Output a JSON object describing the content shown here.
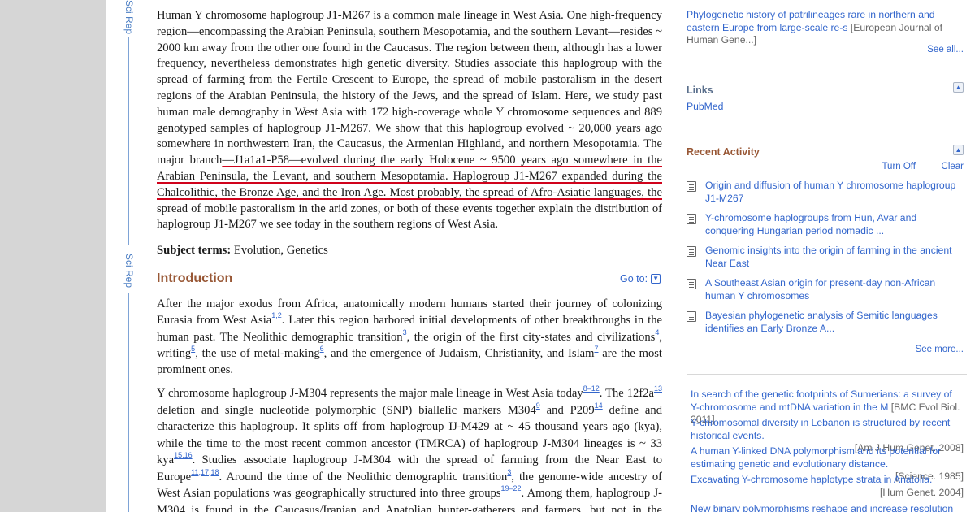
{
  "journal": {
    "tag": "Sci Rep"
  },
  "abstract": {
    "before": "Human Y chromosome haplogroup J1-M267 is a common male lineage in West Asia. One high-frequency region—encompassing the Arabian Peninsula, southern Mesopotamia, and the southern Levant—resides ~ 2000 km away from the other one found in the Caucasus. The region between them, although has a lower frequency, nevertheless demonstrates high genetic diversity. Studies associate this haplogroup with the spread of farming from the Fertile Crescent to Europe, the spread of mobile pastoralism in the desert regions of the Arabian Peninsula, the history of the Jews, and the spread of Islam. Here, we study past human male demography in West Asia with 172 high-coverage whole Y chromosome sequences and 889 genotyped samples of haplogroup J1-M267. We show that this haplogroup evolved ~ 20,000 years ago somewhere in northwestern Iran, the Caucasus, the Armenian Highland, and northern Mesopotamia. The major branch",
    "highlighted": "—J1a1a1-P58—evolved during the early Holocene ~ 9500 years ago somewhere in the Arabian Peninsula, the Levant, and southern Mesopotamia. Haplogroup J1-M267 expanded during the Chalcolithic, the Bronze Age, and the Iron Age. Most probably, the spread of Afro-Asiatic languages, the",
    "after": " spread of mobile pastoralism in the arid zones, or both of these events together explain the distribution of haplogroup J1-M267 we see today in the southern regions of West Asia."
  },
  "subject_terms": {
    "label": "Subject terms:",
    "value": " Evolution, Genetics"
  },
  "introduction": {
    "title": "Introduction",
    "goto_label": "Go to:",
    "p1": {
      "a": "After the major exodus from Africa, anatomically modern humans started their journey of colonizing Eurasia from West Asia",
      "r1": "1,2",
      "b": ". Later this region harbored initial developments of other breakthroughs in the human past. The Neolithic demographic transition",
      "r2": "3",
      "c": ", the origin of the first city-states and civilizations",
      "r3": "4",
      "d": ", writing",
      "r4": "5",
      "e": ", the use of metal-making",
      "r5": "6",
      "f": ", and the emergence of Judaism, Christianity, and Islam",
      "r6": "7",
      "g": " are the most prominent ones."
    },
    "p2": {
      "a": "Y chromosome haplogroup J-M304 represents the major male lineage in West Asia today",
      "r1": "8–12",
      "b": ". The 12f2a",
      "r2": "13",
      "c": " deletion and single nucleotide polymorphic (SNP) biallelic markers M304",
      "r3": "9",
      "d": " and P209",
      "r4": "14",
      "e": " define and characterize this haplogroup. It splits off from haplogroup IJ-M429 at ~ 45 thousand years ago (kya), while the time to the most recent common ancestor (TMRCA) of haplogroup J-M304 lineages is ~ 33 kya",
      "r5": "15,16",
      "f": ". Studies associate haplogroup J-M304 with the spread of farming from the Near East to Europe",
      "r6": "11,17,18",
      "g": ". Around the time of the Neolithic demographic transition",
      "r7": "3",
      "h": ", the genome-wide ancestry of West Asian populations was geographically structured into three groups",
      "r8": "19–22",
      "i": ". Among them, haplogroup J-M304 is found in the Caucasus/Iranian and Anatolian hunter-gatherers and farmers, but not in the Levantine ones"
    }
  },
  "sidebar": {
    "top_item": {
      "title": "Phylogenetic history of patrilineages rare in northern and eastern Europe from large-scale re-s",
      "source": "[European Journal of Human Gene...]"
    },
    "see_all": "See all...",
    "links_heading": "Links",
    "links": [
      "PubMed"
    ],
    "recent_heading": "Recent Activity",
    "turn_off": "Turn Off",
    "clear": "Clear",
    "recent_items": [
      "Origin and diffusion of human Y chromosome haplogroup J1-M267",
      "Y-chromosome haplogroups from Hun, Avar and conquering Hungarian period nomadic ...",
      "Genomic insights into the origin of farming in the ancient Near East",
      "A Southeast Asian origin for present-day non-African human Y chromosomes",
      "Bayesian phylogenetic analysis of Semitic languages identifies an Early Bronze A..."
    ],
    "see_more": "See more...",
    "citations": [
      {
        "title": "In search of the genetic footprints of Sumerians: a survey of Y-chromosome and mtDNA variation in the M",
        "source": "[BMC Evol Biol. 2011]"
      },
      {
        "title": "Y-chromosomal diversity in Lebanon is structured by recent historical events.",
        "source": "[Am J Hum Genet. 2008]"
      },
      {
        "title": "A human Y-linked DNA polymorphism and its potential for estimating genetic and evolutionary distance.",
        "source": "[Science. 1985]"
      },
      {
        "title": "Excavating Y-chromosome haplotype strata in Anatolia.",
        "source": "[Hum Genet. 2004]"
      },
      {
        "title": "New binary polymorphisms reshape and increase resolution of the",
        "source": ""
      }
    ]
  },
  "colors": {
    "accent_heading": "#985735",
    "link": "#3366cc",
    "highlight_underline": "#d0021b",
    "gutter": "#d6d6d6"
  }
}
